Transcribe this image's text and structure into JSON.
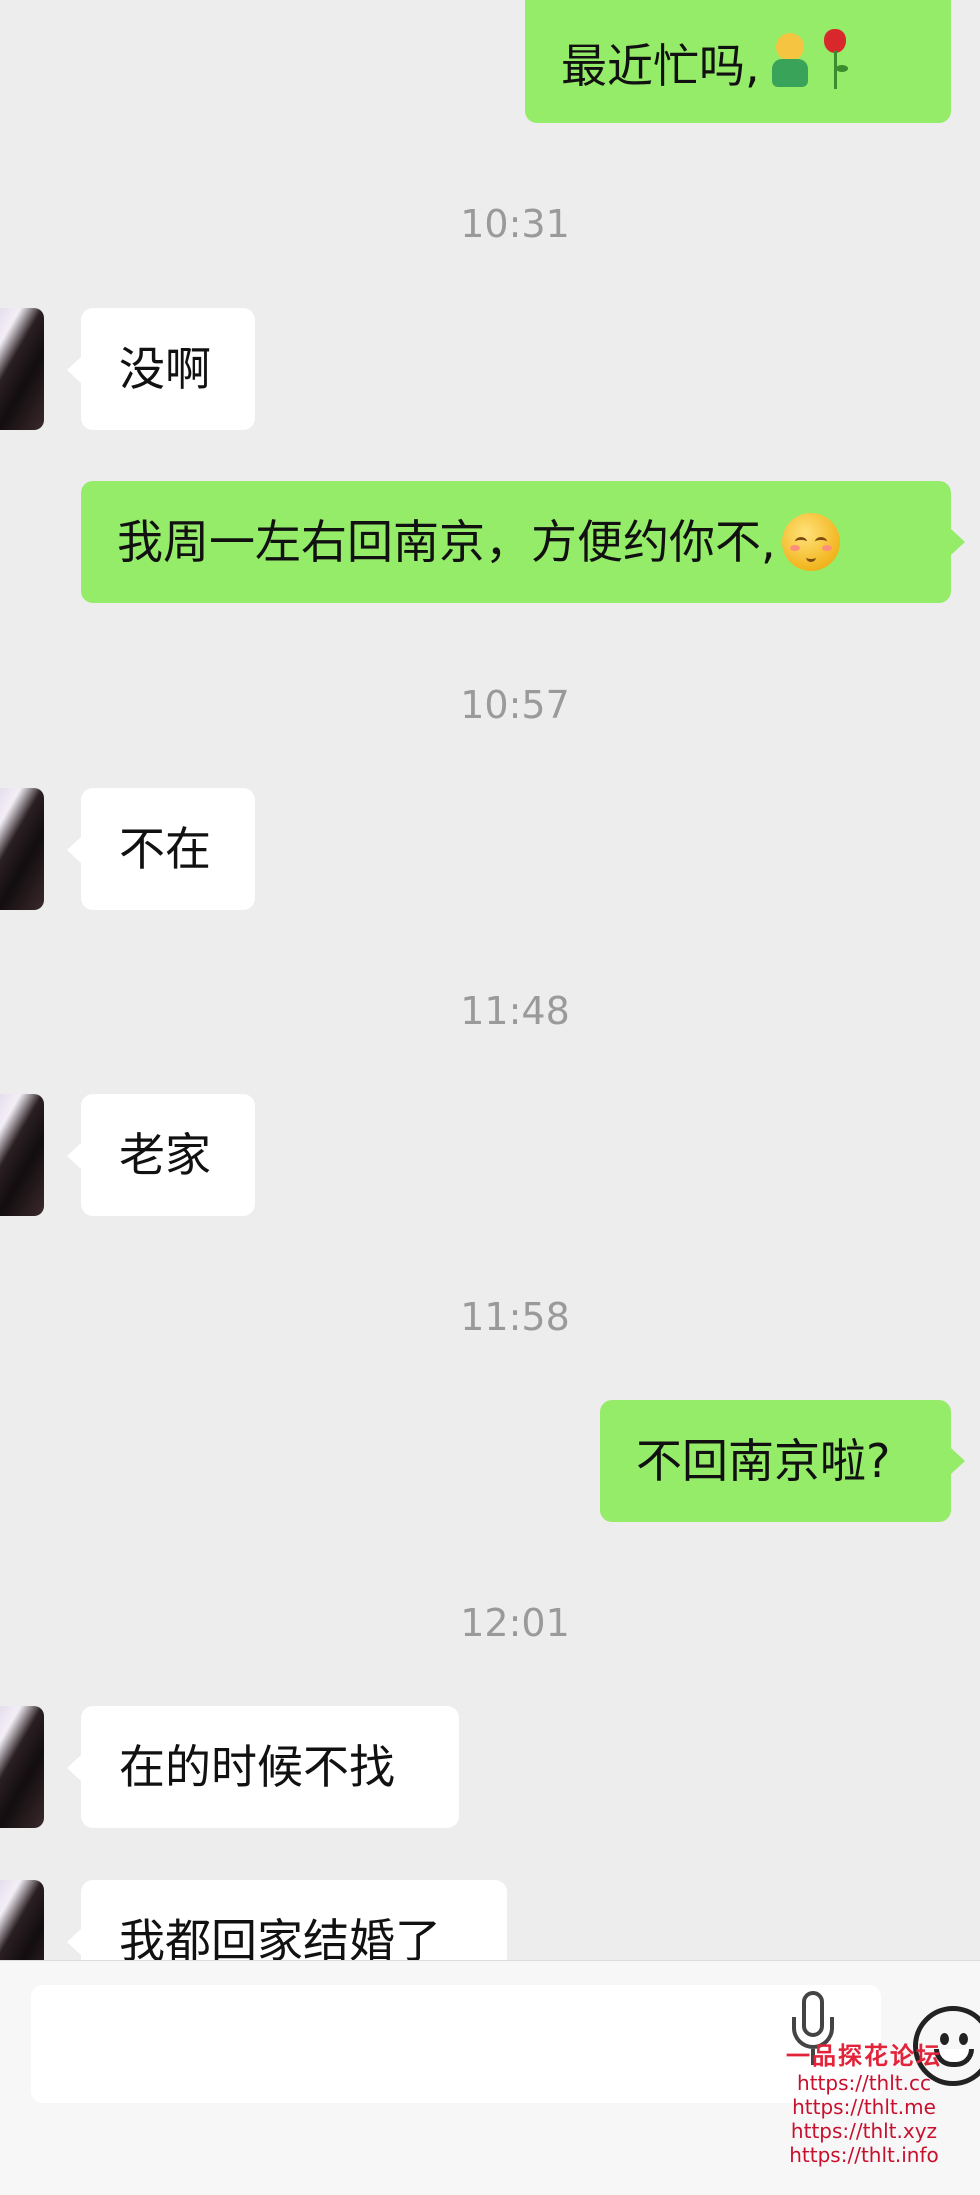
{
  "messages": [
    {
      "text": "最近忙吗,"
    },
    {
      "time": "10:31"
    },
    {
      "text": "没啊"
    },
    {
      "text": "我周一左右回南京，方便约你不,"
    },
    {
      "time": "10:57"
    },
    {
      "text": "不在"
    },
    {
      "time": "11:48"
    },
    {
      "text": "老家"
    },
    {
      "time": "11:58"
    },
    {
      "text": "不回南京啦?"
    },
    {
      "time": "12:01"
    },
    {
      "text": "在的时候不找"
    },
    {
      "text": "我都回家结婚了"
    }
  ],
  "input": {
    "value": "",
    "placeholder": ""
  },
  "icons": {
    "voice": "microphone-icon",
    "emoji": "smiley-face-icon",
    "sticker": "blushing-emoji",
    "figure": "person-emoji",
    "rose": "rose-emoji"
  },
  "watermark": {
    "title": "一品探花论坛",
    "urls": [
      "https://thlt.cc",
      "https://thlt.me",
      "https://thlt.xyz",
      "https://thlt.info"
    ]
  },
  "colors": {
    "outgoing_bubble": "#95ec69",
    "incoming_bubble": "#ffffff",
    "background": "#ededed",
    "timestamp": "#9a9a9a"
  }
}
